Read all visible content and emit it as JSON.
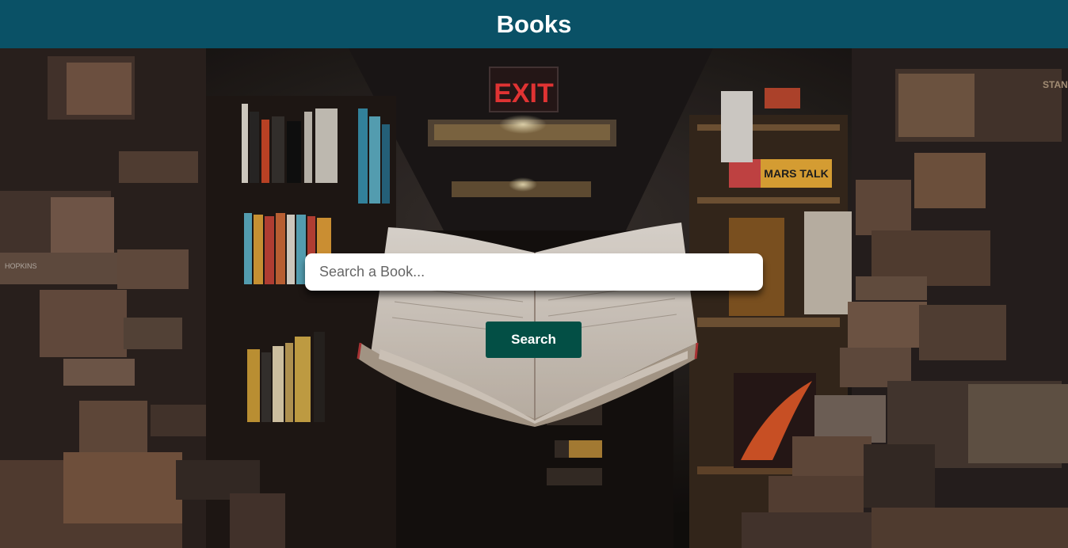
{
  "header": {
    "title": "Books"
  },
  "search": {
    "placeholder": "Search a Book...",
    "value": "",
    "button_label": "Search"
  },
  "background": {
    "exit_sign": "EXIT",
    "spine_text": "MARS TALK",
    "spine_left": "HOPKINS",
    "spine_right": "STAN"
  },
  "colors": {
    "header_bg": "#0a5166",
    "button_bg": "#034f45",
    "exit_red": "#ff3b3b"
  }
}
